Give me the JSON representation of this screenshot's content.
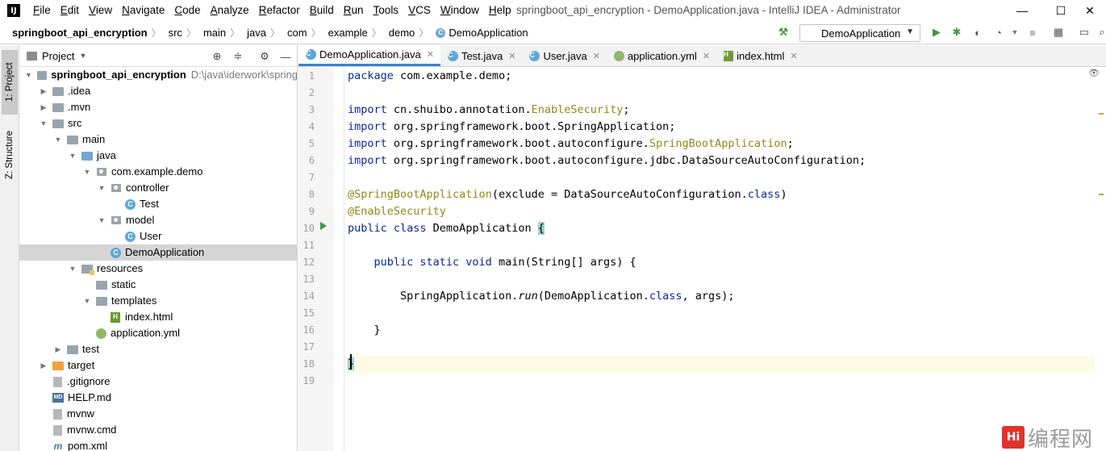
{
  "menubar": {
    "logo": "IJ",
    "items": [
      "File",
      "Edit",
      "View",
      "Navigate",
      "Code",
      "Analyze",
      "Refactor",
      "Build",
      "Run",
      "Tools",
      "VCS",
      "Window",
      "Help"
    ],
    "window_title": "springboot_api_encryption - DemoApplication.java - IntelliJ IDEA - Administrator",
    "minimize": "—",
    "maximize": "☐",
    "close": "✕"
  },
  "navbar": {
    "crumbs": [
      "springboot_api_encryption",
      "src",
      "main",
      "java",
      "com",
      "example",
      "demo",
      "DemoApplication"
    ],
    "run_config": "DemoApplication"
  },
  "left_strip": {
    "project_tab": "1: Project",
    "structure_tab": "Z: Structure"
  },
  "project_panel": {
    "title": "Project",
    "tree": [
      {
        "label": "springboot_api_encryption",
        "path": "D:\\java\\iderwork\\spring",
        "level": 0,
        "toggle": "▼",
        "icon": "folder",
        "bold": true
      },
      {
        "label": ".idea",
        "level": 1,
        "toggle": "▶",
        "icon": "folder"
      },
      {
        "label": ".mvn",
        "level": 1,
        "toggle": "▶",
        "icon": "folder"
      },
      {
        "label": "src",
        "level": 1,
        "toggle": "▼",
        "icon": "folder"
      },
      {
        "label": "main",
        "level": 2,
        "toggle": "▼",
        "icon": "folder"
      },
      {
        "label": "java",
        "level": 3,
        "toggle": "▼",
        "icon": "folder-src"
      },
      {
        "label": "com.example.demo",
        "level": 4,
        "toggle": "▼",
        "icon": "pkg"
      },
      {
        "label": "controller",
        "level": 5,
        "toggle": "▼",
        "icon": "pkg"
      },
      {
        "label": "Test",
        "level": 6,
        "toggle": "",
        "icon": "class"
      },
      {
        "label": "model",
        "level": 5,
        "toggle": "▼",
        "icon": "pkg"
      },
      {
        "label": "User",
        "level": 6,
        "toggle": "",
        "icon": "class"
      },
      {
        "label": "DemoApplication",
        "level": 5,
        "toggle": "",
        "icon": "class",
        "selected": true
      },
      {
        "label": "resources",
        "level": 3,
        "toggle": "▼",
        "icon": "res"
      },
      {
        "label": "static",
        "level": 4,
        "toggle": "",
        "icon": "folder"
      },
      {
        "label": "templates",
        "level": 4,
        "toggle": "▼",
        "icon": "folder"
      },
      {
        "label": "index.html",
        "level": 5,
        "toggle": "",
        "icon": "html"
      },
      {
        "label": "application.yml",
        "level": 4,
        "toggle": "",
        "icon": "yml"
      },
      {
        "label": "test",
        "level": 2,
        "toggle": "▶",
        "icon": "folder"
      },
      {
        "label": "target",
        "level": 1,
        "toggle": "▶",
        "icon": "folder-orange"
      },
      {
        "label": ".gitignore",
        "level": 1,
        "toggle": "",
        "icon": "file"
      },
      {
        "label": "HELP.md",
        "level": 1,
        "toggle": "",
        "icon": "md"
      },
      {
        "label": "mvnw",
        "level": 1,
        "toggle": "",
        "icon": "file"
      },
      {
        "label": "mvnw.cmd",
        "level": 1,
        "toggle": "",
        "icon": "file"
      },
      {
        "label": "pom.xml",
        "level": 1,
        "toggle": "",
        "icon": "xml"
      }
    ]
  },
  "editor": {
    "tabs": [
      {
        "label": "DemoApplication.java",
        "icon": "class",
        "active": true
      },
      {
        "label": "Test.java",
        "icon": "class"
      },
      {
        "label": "User.java",
        "icon": "class"
      },
      {
        "label": "application.yml",
        "icon": "yml"
      },
      {
        "label": "index.html",
        "icon": "html"
      }
    ],
    "line_numbers": [
      "1",
      "2",
      "3",
      "4",
      "5",
      "6",
      "7",
      "8",
      "9",
      "10",
      "11",
      "12",
      "13",
      "14",
      "15",
      "16",
      "17",
      "18",
      "19"
    ],
    "lines": [
      [
        {
          "t": "package",
          "c": "kw"
        },
        {
          "t": " com.example.demo;"
        }
      ],
      [],
      [
        {
          "t": "import",
          "c": "kw"
        },
        {
          "t": " cn.shuibo.annotation."
        },
        {
          "t": "EnableSecurity",
          "c": "ann"
        },
        {
          "t": ";"
        }
      ],
      [
        {
          "t": "import",
          "c": "kw"
        },
        {
          "t": " org.springframework.boot.SpringApplication;"
        }
      ],
      [
        {
          "t": "import",
          "c": "kw"
        },
        {
          "t": " org.springframework.boot.autoconfigure."
        },
        {
          "t": "SpringBootApplication",
          "c": "ann"
        },
        {
          "t": ";"
        }
      ],
      [
        {
          "t": "import",
          "c": "kw"
        },
        {
          "t": " org.springframework.boot.autoconfigure.jdbc.DataSourceAutoConfiguration;"
        }
      ],
      [],
      [
        {
          "t": "@SpringBootApplication",
          "c": "ann"
        },
        {
          "t": "(exclude = DataSourceAutoConfiguration."
        },
        {
          "t": "class",
          "c": "kw"
        },
        {
          "t": ")"
        }
      ],
      [
        {
          "t": "@EnableSecurity",
          "c": "ann"
        }
      ],
      [
        {
          "t": "public class",
          "c": "kw"
        },
        {
          "t": " DemoApplication "
        },
        {
          "t": "{",
          "c": "brace-hl"
        }
      ],
      [],
      [
        {
          "t": "    "
        },
        {
          "t": "public static void",
          "c": "kw"
        },
        {
          "t": " main(String[] args) {"
        }
      ],
      [],
      [
        {
          "t": "        SpringApplication."
        },
        {
          "t": "run",
          "c": "it"
        },
        {
          "t": "(DemoApplication."
        },
        {
          "t": "class",
          "c": "kw"
        },
        {
          "t": ", args);"
        }
      ],
      [],
      [
        {
          "t": "    }"
        }
      ],
      [],
      [
        {
          "t": "}",
          "c": "brace-hl"
        }
      ],
      []
    ],
    "current_line": 18
  },
  "watermark": {
    "logo": "Hi",
    "text": "编程网"
  }
}
